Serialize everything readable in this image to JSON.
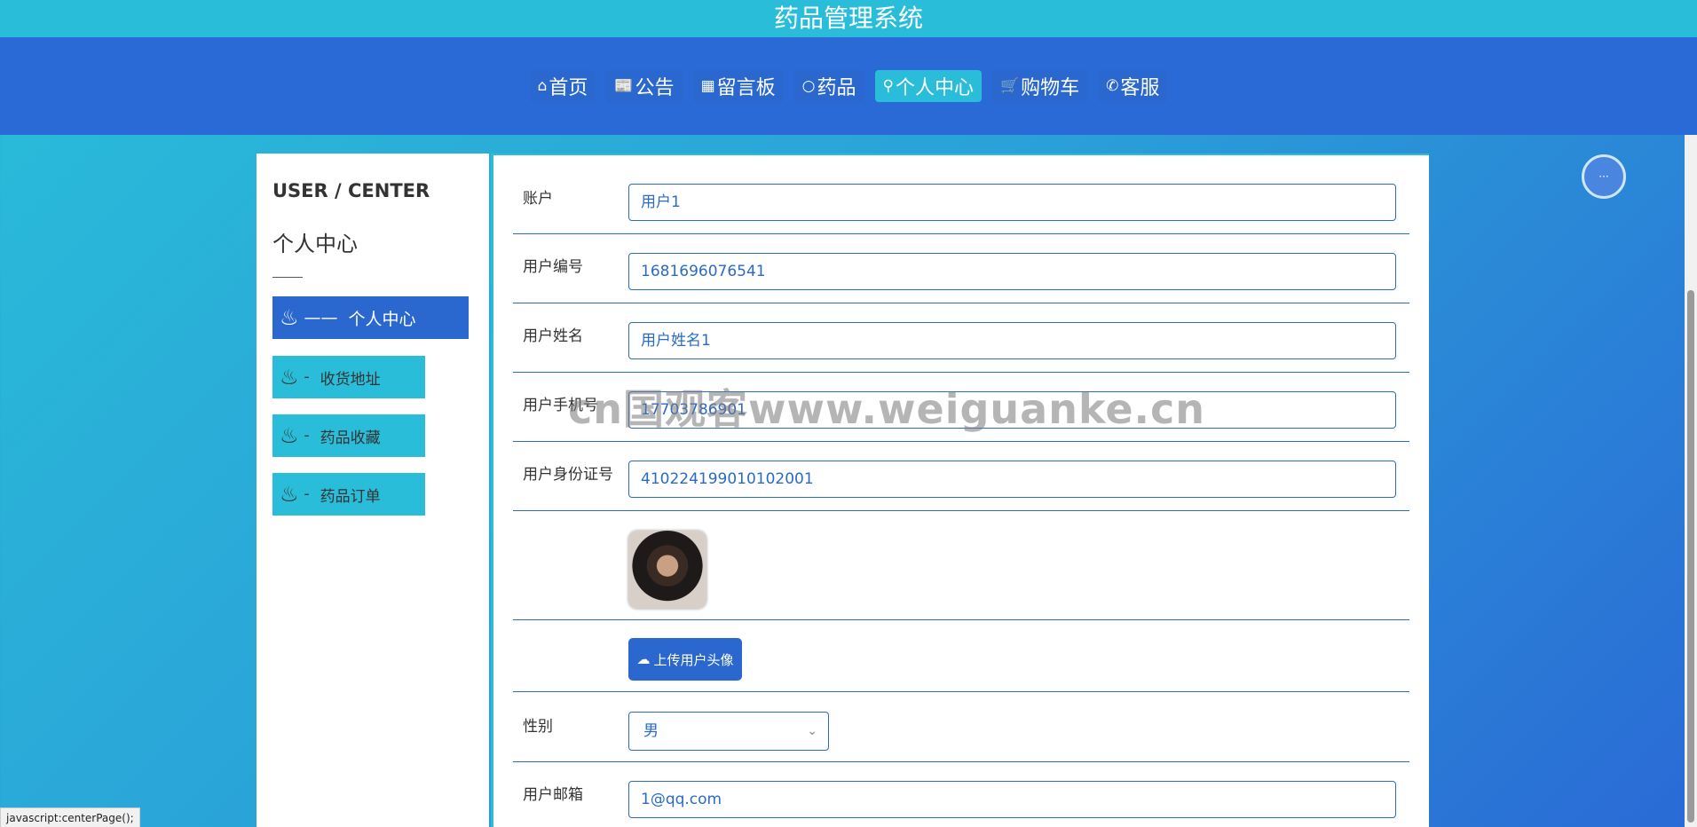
{
  "app_title": "药品管理系统",
  "nav": [
    {
      "icon": "⌂",
      "icon_name": "home-icon",
      "label": "首页",
      "active": false
    },
    {
      "icon": "📰",
      "icon_name": "notice-icon",
      "label": "公告",
      "active": false
    },
    {
      "icon": "▦",
      "icon_name": "message-board-icon",
      "label": "留言板",
      "active": false
    },
    {
      "icon": "○",
      "icon_name": "medicine-icon",
      "label": "药品",
      "active": false
    },
    {
      "icon": "⚲",
      "icon_name": "user-icon",
      "label": "个人中心",
      "active": true
    },
    {
      "icon": "🛒",
      "icon_name": "cart-icon",
      "label": "购物车",
      "active": false
    },
    {
      "icon": "✆",
      "icon_name": "service-icon",
      "label": "客服",
      "active": false
    }
  ],
  "sidebar": {
    "en_title": "USER / CENTER",
    "cn_title": "个人中心",
    "items": [
      {
        "label": "个人中心",
        "dash": "——",
        "active": true
      },
      {
        "label": "收货地址",
        "dash": "-",
        "active": false
      },
      {
        "label": "药品收藏",
        "dash": "-",
        "active": false
      },
      {
        "label": "药品订单",
        "dash": "-",
        "active": false
      }
    ]
  },
  "form": {
    "account": {
      "label": "账户",
      "value": "用户1"
    },
    "user_no": {
      "label": "用户编号",
      "value": "1681696076541"
    },
    "user_name": {
      "label": "用户姓名",
      "value": "用户姓名1"
    },
    "phone": {
      "label": "用户手机号",
      "value": "17703786901"
    },
    "id_card": {
      "label": "用户身份证号",
      "value": "410224199010102001"
    },
    "upload_label": "上传用户头像",
    "gender": {
      "label": "性别",
      "value": "男"
    },
    "email": {
      "label": "用户邮箱",
      "value": "1@qq.com"
    }
  },
  "watermark": "cn国观客www.weiguanke.cn",
  "float_button": "···",
  "status_text": "javascript:centerPage();"
}
